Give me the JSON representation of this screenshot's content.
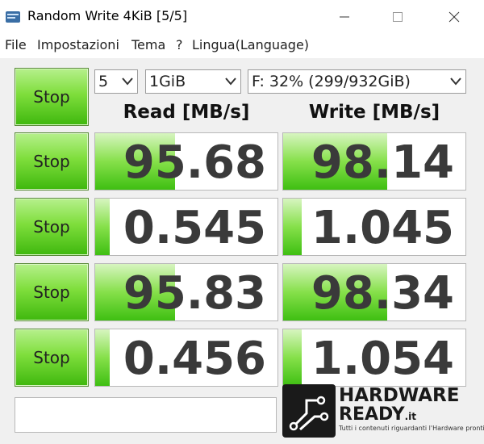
{
  "window": {
    "title": "Random Write 4KiB [5/5]"
  },
  "menu": {
    "items": [
      "File",
      "Impostazioni",
      "Tema",
      "?",
      "Lingua(Language)"
    ]
  },
  "controls": {
    "count": "5",
    "size": "1GiB",
    "drive": "F: 32% (299/932GiB)",
    "stop_label": "Stop"
  },
  "headers": {
    "read": "Read [MB/s]",
    "write": "Write [MB/s]"
  },
  "results": [
    {
      "read": "95.68",
      "write": "98.14",
      "read_fill": 0.44,
      "write_fill": 0.57
    },
    {
      "read": "0.545",
      "write": "1.045",
      "read_fill": 0.08,
      "write_fill": 0.1
    },
    {
      "read": "95.83",
      "write": "98.34",
      "read_fill": 0.44,
      "write_fill": 0.57
    },
    {
      "read": "0.456",
      "write": "1.054",
      "read_fill": 0.08,
      "write_fill": 0.1
    }
  ],
  "watermark": {
    "brand_line1": "HARDWARE",
    "brand_line2": "READY",
    "brand_suffix": ".it",
    "tagline": "Tutti i contenuti riguardanti l'Hardware pronti per te!"
  },
  "colors": {
    "bar_green": "#5fcf22",
    "button_green": "#7fde3c"
  }
}
